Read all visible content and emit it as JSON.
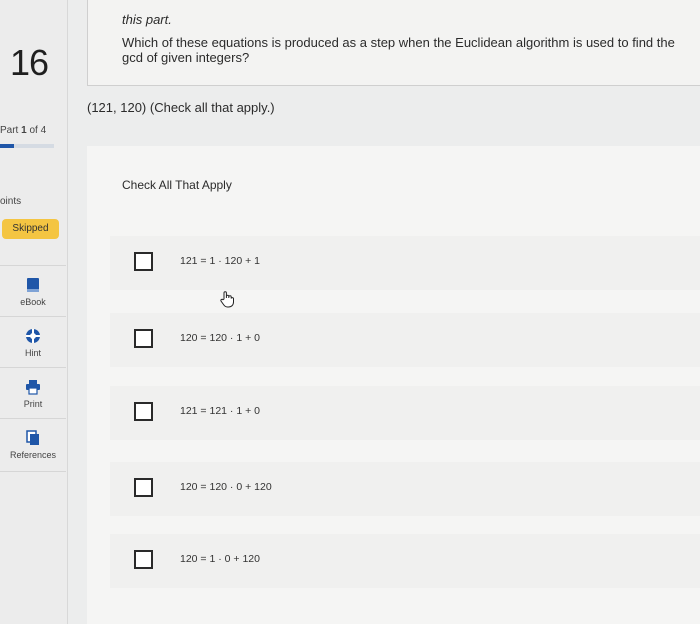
{
  "sidebar": {
    "question_number": "16",
    "part_label": "Part",
    "part_current": "1",
    "part_of": "of 4",
    "part_progress_fraction": 0.25,
    "points_label": "oints",
    "status_badge": "Skipped",
    "tools": [
      {
        "label": "eBook",
        "icon": "ebook-icon"
      },
      {
        "label": "Hint",
        "icon": "hint-icon"
      },
      {
        "label": "Print",
        "icon": "print-icon"
      },
      {
        "label": "References",
        "icon": "references-icon"
      }
    ]
  },
  "question": {
    "intro": "this part.",
    "text": "Which of these equations is produced as a step when the Euclidean algorithm is used to find the gcd of given integers?",
    "sub_prompt": "(121, 120) (Check all that apply.)",
    "instructions": "Check All That Apply",
    "choices": [
      {
        "label": "121 = 1 · 120 + 1",
        "checked": false
      },
      {
        "label": "120 = 120 · 1 + 0",
        "checked": false
      },
      {
        "label": "121 = 121 · 1 + 0",
        "checked": false
      },
      {
        "label": "120 = 120 · 0 + 120",
        "checked": false
      },
      {
        "label": "120 = 1 · 0 + 120",
        "checked": false
      }
    ]
  },
  "colors": {
    "skipped_badge": "#f4c542",
    "accent_blue": "#1f56a8"
  }
}
